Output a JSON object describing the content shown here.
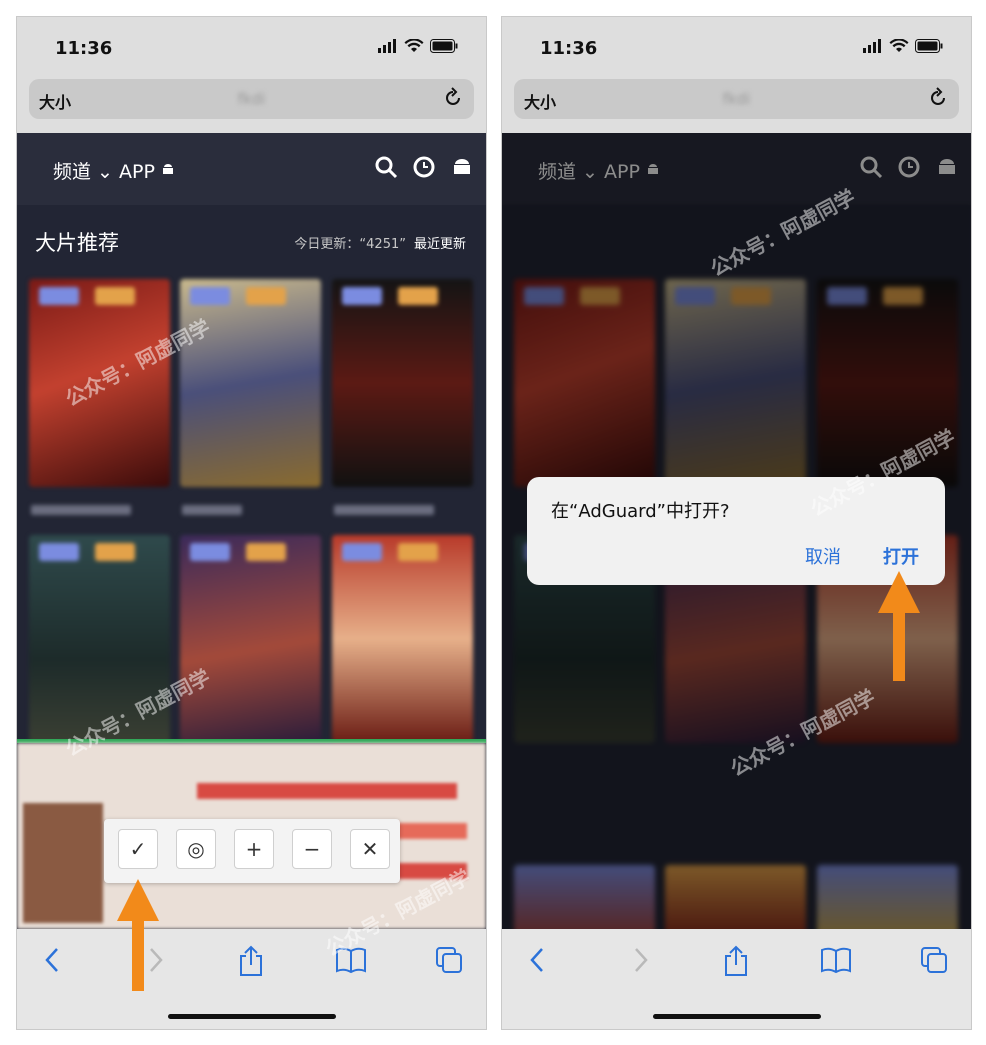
{
  "status": {
    "time": "11:36"
  },
  "browser": {
    "text_size_label": "大小",
    "url": "fkdi"
  },
  "site": {
    "channel_label": "频道 ⌄ APP",
    "section_title": "大片推荐",
    "today_update": "今日更新：“4251”",
    "latest_update": "最近更新"
  },
  "adguard_toolbar": {
    "buttons": [
      {
        "name": "confirm",
        "glyph": "✓"
      },
      {
        "name": "preview",
        "glyph": "◎"
      },
      {
        "name": "expand",
        "glyph": "+"
      },
      {
        "name": "shrink",
        "glyph": "−"
      },
      {
        "name": "close",
        "glyph": "✕"
      }
    ]
  },
  "dialog": {
    "title": "在“AdGuard”中打开?",
    "cancel": "取消",
    "open": "打开"
  },
  "watermark": {
    "text": "公众号：阿虚同学"
  },
  "colors": {
    "page_bg": "#222534",
    "header_bg": "#2a2d3c",
    "dialog_button": "#2c72d9",
    "arrow": "#f28a1a",
    "ios_blue": "#2c72d9"
  }
}
